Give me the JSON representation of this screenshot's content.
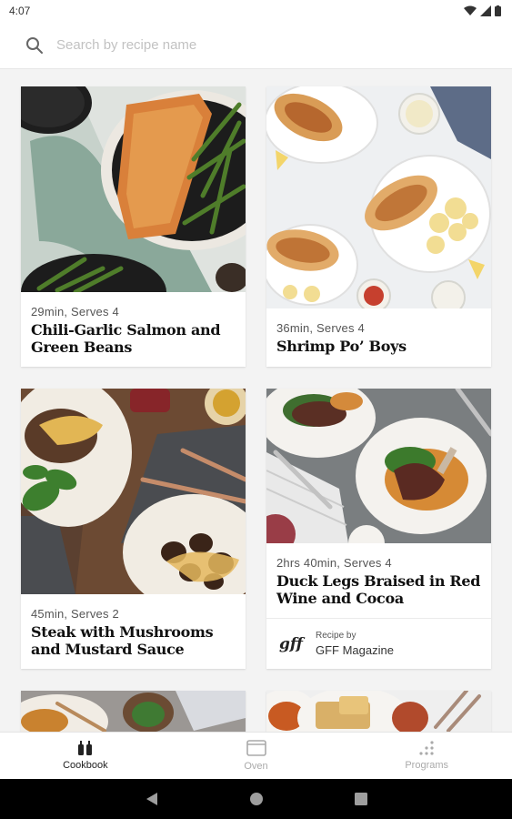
{
  "status_bar": {
    "time": "4:07"
  },
  "search": {
    "placeholder": "Search by recipe name"
  },
  "recipes": [
    {
      "meta": "29min, Serves 4",
      "title": "Chili-Garlic Salmon and Green Beans"
    },
    {
      "meta": "36min, Serves 4",
      "title": "Shrimp Po’ Boys"
    },
    {
      "meta": "45min, Serves 2",
      "title": "Steak with Mushrooms and Mustard Sauce"
    },
    {
      "meta": "2hrs 40min, Serves 4",
      "title": "Duck Legs Braised in Red Wine and Cocoa",
      "byline": {
        "logo": "gff",
        "recipe_by": "Recipe by",
        "author": "GFF Magazine"
      }
    }
  ],
  "bottom_nav": {
    "items": [
      {
        "label": "Cookbook",
        "icon": "cookbook-icon",
        "active": true
      },
      {
        "label": "Oven",
        "icon": "oven-icon",
        "active": false
      },
      {
        "label": "Programs",
        "icon": "programs-icon",
        "active": false
      }
    ]
  },
  "system_nav": {
    "back": "back-icon",
    "home": "home-icon",
    "recents": "recents-icon"
  },
  "colors": {
    "background": "#f3f3f3",
    "card": "#ffffff",
    "text": "#111111",
    "muted": "#aaaaaa"
  }
}
